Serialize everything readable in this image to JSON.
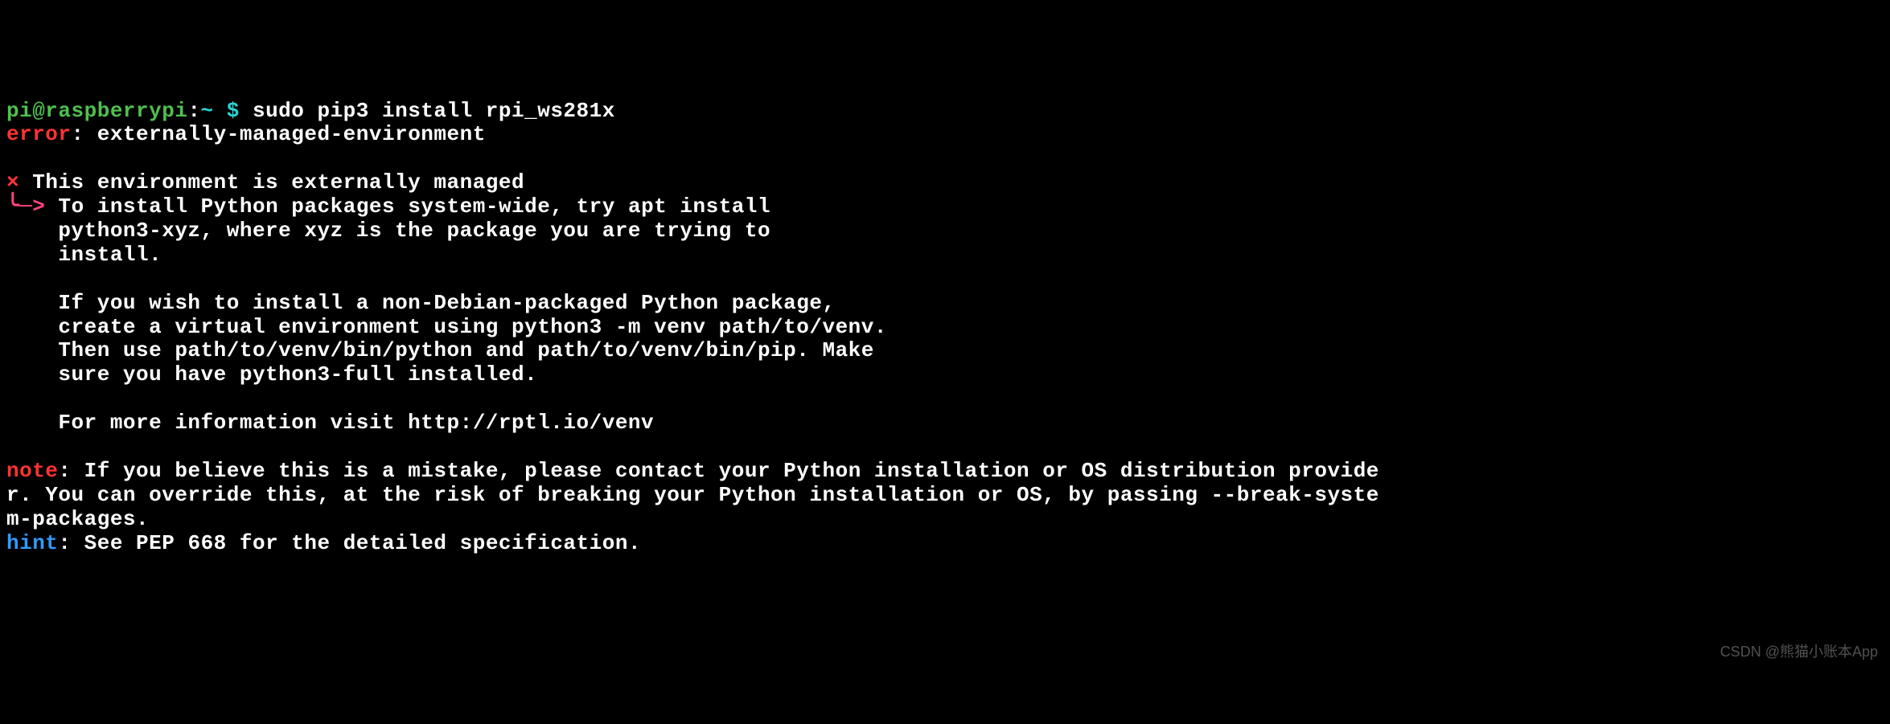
{
  "prompt": {
    "user": "pi@raspberrypi",
    "colon1": ":",
    "path": "~ $",
    "command": " sudo pip3 install rpi_ws281x"
  },
  "error_line": {
    "label": "error",
    "sep": ": ",
    "msg": "externally-managed-environment"
  },
  "block": {
    "cross": "×",
    "header": " This environment is externally managed",
    "arrow": "╰─>",
    "lines": [
      " To install Python packages system-wide, try apt install",
      "    python3-xyz, where xyz is the package you are trying to",
      "    install.",
      "    ",
      "    If you wish to install a non-Debian-packaged Python package,",
      "    create a virtual environment using python3 -m venv path/to/venv.",
      "    Then use path/to/venv/bin/python and path/to/venv/bin/pip. Make",
      "    sure you have python3-full installed.",
      "    ",
      "    For more information visit http://rptl.io/venv"
    ]
  },
  "note": {
    "label": "note",
    "sep": ": ",
    "text": "If you believe this is a mistake, please contact your Python installation or OS distribution provider. You can override this, at the risk of breaking your Python installation or OS, by passing --break-system-packages."
  },
  "hint": {
    "label": "hint",
    "sep": ": ",
    "text": "See PEP 668 for the detailed specification."
  },
  "watermark": "CSDN @熊猫小账本App"
}
